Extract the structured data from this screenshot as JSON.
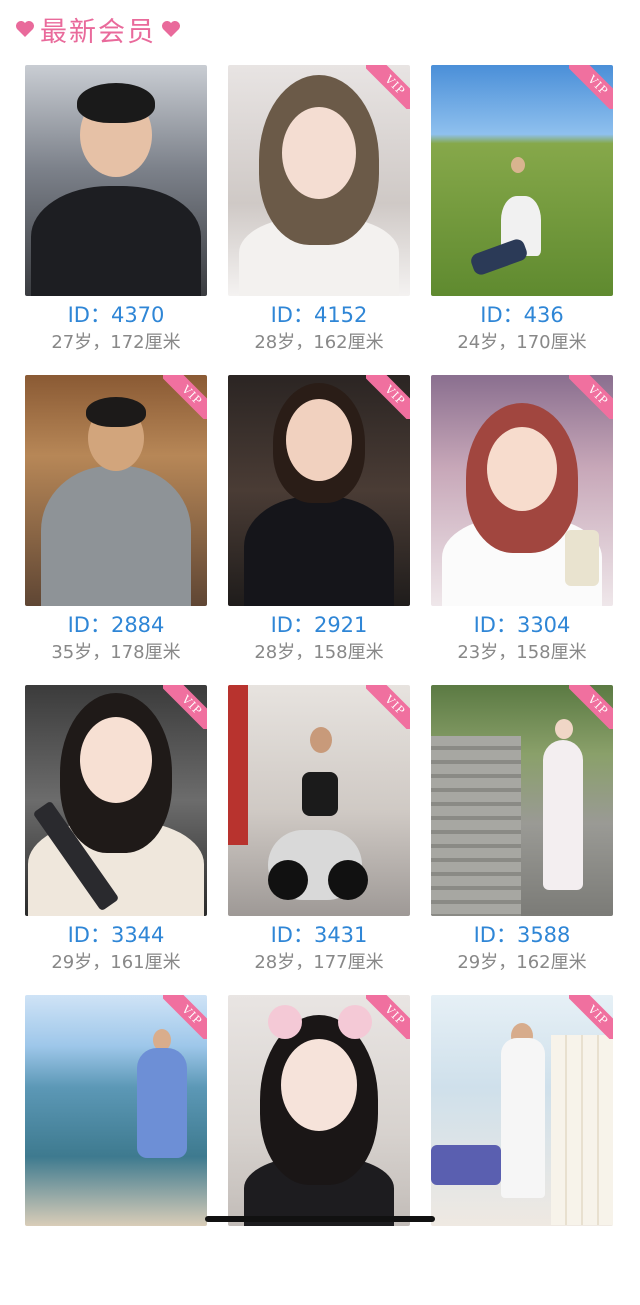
{
  "header": {
    "title": "最新会员",
    "accent_color": "#e96a9b",
    "left_icon": "heart-icon",
    "right_icon": "heart-icon"
  },
  "vip_label": "VIP",
  "colors": {
    "id_text": "#2f86d6",
    "meta_text": "#888888",
    "vip_ribbon": "#f0709f"
  },
  "members": [
    {
      "id_label": "ID：4370",
      "meta": "27岁，172厘米",
      "vip": false
    },
    {
      "id_label": "ID：4152",
      "meta": "28岁，162厘米",
      "vip": true
    },
    {
      "id_label": "ID：436",
      "meta": "24岁，170厘米",
      "vip": true
    },
    {
      "id_label": "ID：2884",
      "meta": "35岁，178厘米",
      "vip": true
    },
    {
      "id_label": "ID：2921",
      "meta": "28岁，158厘米",
      "vip": true
    },
    {
      "id_label": "ID：3304",
      "meta": "23岁，158厘米",
      "vip": true
    },
    {
      "id_label": "ID：3344",
      "meta": "29岁，161厘米",
      "vip": true
    },
    {
      "id_label": "ID：3431",
      "meta": "28岁，177厘米",
      "vip": true
    },
    {
      "id_label": "ID：3588",
      "meta": "29岁，162厘米",
      "vip": true
    },
    {
      "id_label": "",
      "meta": "",
      "vip": true
    },
    {
      "id_label": "",
      "meta": "",
      "vip": true
    },
    {
      "id_label": "",
      "meta": "",
      "vip": true
    }
  ]
}
